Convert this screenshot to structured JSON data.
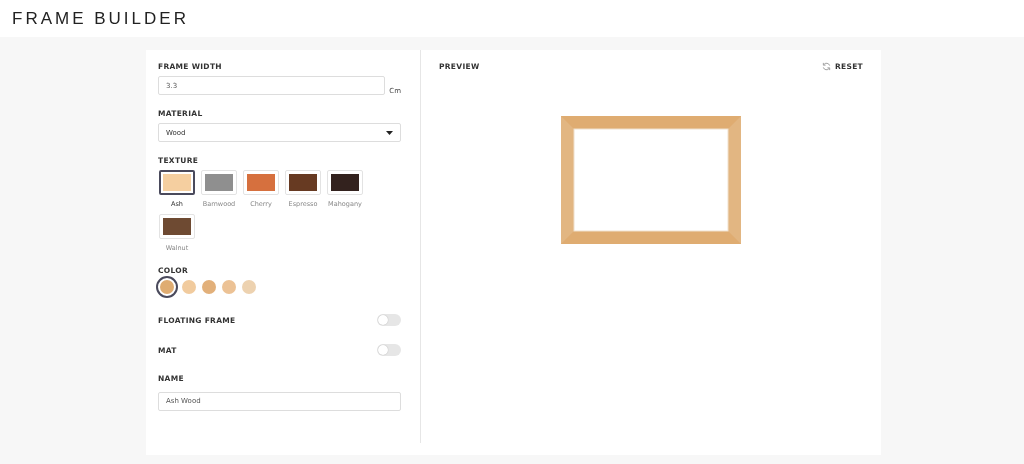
{
  "header": {
    "title": "FRAME BUILDER"
  },
  "form": {
    "frame_width": {
      "label": "FRAME WIDTH",
      "value": "3.3",
      "unit": "Cm"
    },
    "material": {
      "label": "MATERIAL",
      "value": "Wood"
    },
    "texture": {
      "label": "TEXTURE",
      "items": [
        {
          "label": "Ash",
          "color": "#f5cfa0",
          "selected": true
        },
        {
          "label": "Barnwood",
          "color": "#8f8f8f",
          "selected": false
        },
        {
          "label": "Cherry",
          "color": "#d6703e",
          "selected": false
        },
        {
          "label": "Espresso",
          "color": "#673a22",
          "selected": false
        },
        {
          "label": "Mahogany",
          "color": "#33221e",
          "selected": false
        },
        {
          "label": "Walnut",
          "color": "#6e4a32",
          "selected": false
        }
      ]
    },
    "color": {
      "label": "COLOR",
      "items": [
        {
          "color": "#dfac71",
          "selected": true
        },
        {
          "color": "#f1cb9e",
          "selected": false
        },
        {
          "color": "#e2b07a",
          "selected": false
        },
        {
          "color": "#ecc295",
          "selected": false
        },
        {
          "color": "#edd2b0",
          "selected": false
        }
      ]
    },
    "toggles": [
      {
        "label": "FLOATING FRAME",
        "on": false
      },
      {
        "label": "MAT",
        "on": false
      }
    ],
    "name": {
      "label": "NAME",
      "value": "Ash Wood"
    }
  },
  "preview": {
    "label": "PREVIEW",
    "reset": "RESET"
  }
}
